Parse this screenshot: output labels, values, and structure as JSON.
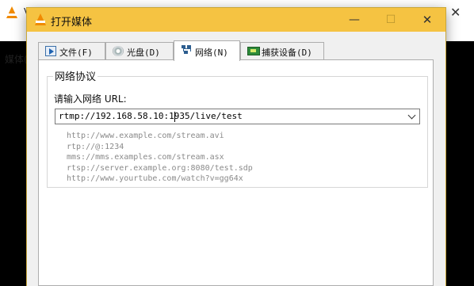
{
  "background_window": {
    "title": "V",
    "menu_first": "媒体(",
    "close_glyph": "✕"
  },
  "dialog": {
    "title": "打开媒体",
    "controls": {
      "minimize": "—",
      "maximize": "☐",
      "close": "✕"
    }
  },
  "tabs": [
    {
      "label": "文件(F)",
      "icon": "file-play-icon"
    },
    {
      "label": "光盘(D)",
      "icon": "disc-icon"
    },
    {
      "label": "网络(N)",
      "icon": "network-icon",
      "selected": true
    },
    {
      "label": "捕获设备(D)",
      "icon": "capture-card-icon"
    }
  ],
  "network": {
    "group_title": "网络协议",
    "prompt": "请输入网络 URL:",
    "url_value": "rtmp://192.168.58.10:1935/live/test",
    "examples": [
      "http://www.example.com/stream.avi",
      "rtp://@:1234",
      "mms://mms.examples.com/stream.asx",
      "rtsp://server.example.org:8080/test.sdp",
      "http://www.yourtube.com/watch?v=gg64x"
    ]
  },
  "colors": {
    "dialog_titlebar": "#f5c342",
    "vlc_cone": "#f08a00",
    "example_text": "#8a8a8a"
  }
}
